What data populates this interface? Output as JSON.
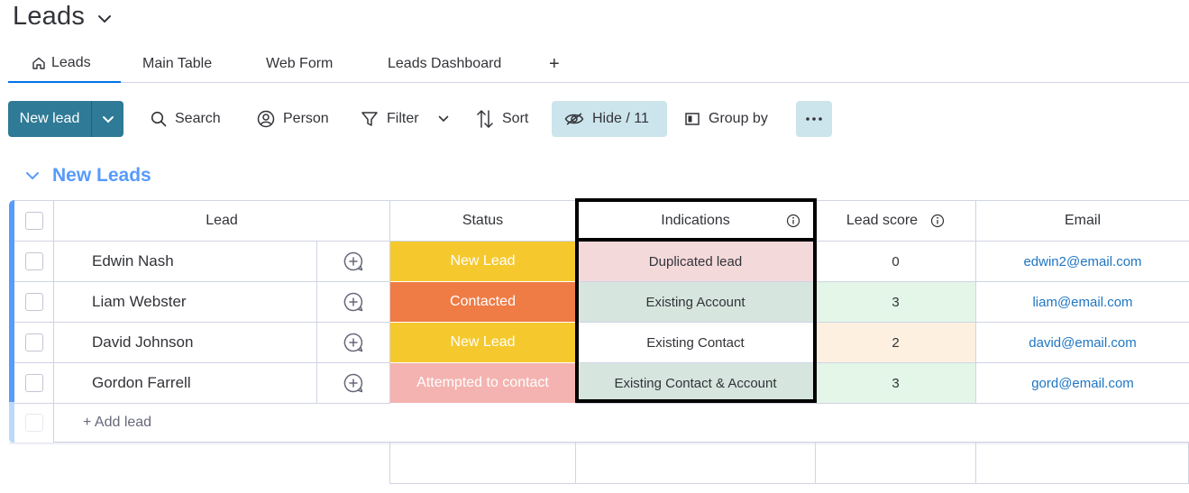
{
  "board": {
    "title": "Leads"
  },
  "tabs": [
    {
      "label": "Leads",
      "active": true,
      "icon": "home-icon"
    },
    {
      "label": "Main Table"
    },
    {
      "label": "Web Form"
    },
    {
      "label": "Leads Dashboard"
    },
    {
      "label": "+"
    }
  ],
  "toolbar": {
    "new_lead": "New lead",
    "search": "Search",
    "person": "Person",
    "filter": "Filter",
    "sort": "Sort",
    "hide": "Hide / 11",
    "group_by": "Group by",
    "more": "..."
  },
  "group": {
    "title": "New Leads",
    "color": "#579bfc"
  },
  "columns": {
    "lead": "Lead",
    "status": "Status",
    "indications": "Indications",
    "lead_score": "Lead score",
    "email": "Email"
  },
  "rows": [
    {
      "name": "Edwin Nash",
      "status": "New Lead",
      "status_color": "#f5c92e",
      "indication": "Duplicated lead",
      "indication_bg": "#f4d9db",
      "score": "0",
      "score_bg": "#ffffff",
      "email": "edwin2@email.com"
    },
    {
      "name": "Liam Webster",
      "status": "Contacted",
      "status_color": "#ef7b45",
      "indication": "Existing Account",
      "indication_bg": "#d6e6df",
      "score": "3",
      "score_bg": "#e3f6e8",
      "email": "liam@email.com"
    },
    {
      "name": "David Johnson",
      "status": "New Lead",
      "status_color": "#f5c92e",
      "indication": "Existing Contact",
      "indication_bg": "#ffffff",
      "score": "2",
      "score_bg": "#fdf0e0",
      "email": "david@email.com"
    },
    {
      "name": "Gordon Farrell",
      "status": "Attempted to contact",
      "status_color": "#f4b3b0",
      "indication": "Existing Contact & Account",
      "indication_bg": "#d6e6df",
      "score": "3",
      "score_bg": "#e3f6e8",
      "email": "gord@email.com"
    }
  ],
  "add_lead": "+ Add lead"
}
